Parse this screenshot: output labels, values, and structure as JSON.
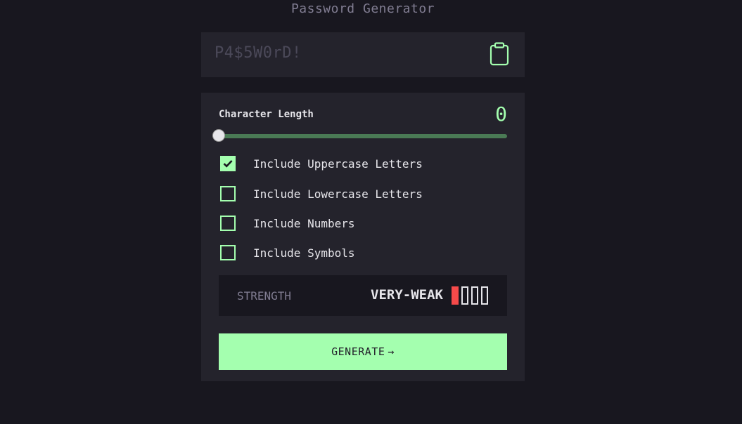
{
  "app": {
    "title": "Password Generator"
  },
  "password": {
    "value": "P4$5W0rD!",
    "copy_icon": "clipboard-icon"
  },
  "length": {
    "label": "Character Length",
    "value": "0",
    "slider_fraction": 0
  },
  "options": [
    {
      "label": "Include Uppercase Letters",
      "checked": true
    },
    {
      "label": "Include Lowercase Letters",
      "checked": false
    },
    {
      "label": "Include Numbers",
      "checked": false
    },
    {
      "label": "Include Symbols",
      "checked": false
    }
  ],
  "strength": {
    "label": "STRENGTH",
    "value": "VERY-WEAK",
    "bars_filled": 1,
    "bars_total": 4
  },
  "generate": {
    "label": "GENERATE",
    "icon": "arrow-right-icon",
    "arrow": "→"
  },
  "colors": {
    "background": "#18171f",
    "panel": "#24232c",
    "accent": "#a4ffaf",
    "text": "#e6e5ea",
    "muted": "#817d92",
    "weak": "#f64a4a"
  }
}
